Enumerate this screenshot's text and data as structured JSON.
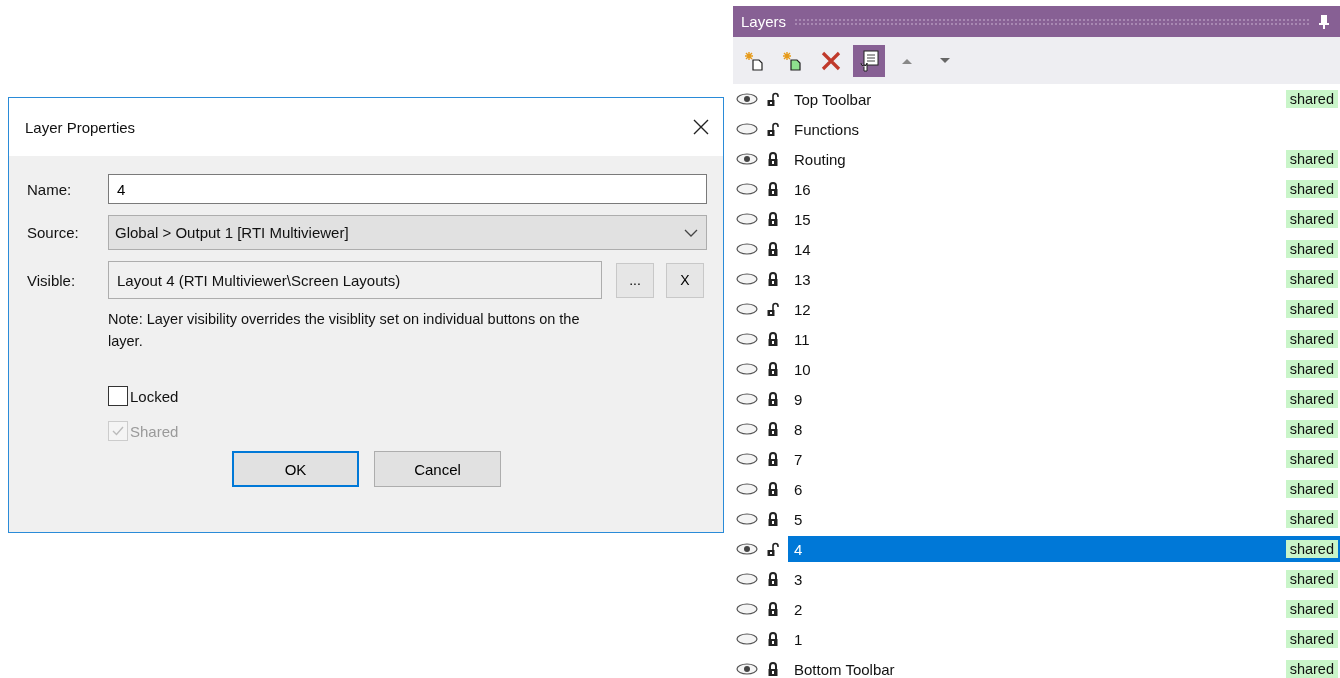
{
  "dialog": {
    "title": "Layer Properties",
    "name_label": "Name:",
    "name_value": "4",
    "source_label": "Source:",
    "source_value": "Global > Output 1 [RTI Multiviewer]",
    "visible_label": "Visible:",
    "visible_value": "Layout 4 (RTI Multiviewer\\Screen Layouts)",
    "browse_button": "...",
    "clear_button": "X",
    "note": "Note: Layer visibility overrides the visiblity set on individual buttons on the layer.",
    "checkboxes": [
      {
        "label": "Locked",
        "checked": false,
        "disabled": false
      },
      {
        "label": "Shared",
        "checked": true,
        "disabled": true
      }
    ],
    "buttons": [
      {
        "label": "OK",
        "default": true
      },
      {
        "label": "Cancel",
        "default": false
      }
    ]
  },
  "layers_panel": {
    "title": "Layers",
    "tools": [
      {
        "kind": "new",
        "pressed": false
      },
      {
        "kind": "new-filled",
        "pressed": false
      },
      {
        "kind": "delete",
        "pressed": false
      },
      {
        "kind": "properties",
        "pressed": true
      },
      {
        "kind": "up",
        "pressed": false
      },
      {
        "kind": "down",
        "pressed": false
      }
    ],
    "rows": [
      {
        "name": "Top Toolbar",
        "visible": true,
        "locked": false,
        "tag": "shared",
        "selected": false
      },
      {
        "name": "Functions",
        "visible": false,
        "locked": false,
        "selected": false
      },
      {
        "name": "Routing",
        "visible": true,
        "locked": true,
        "tag": "shared",
        "selected": false
      },
      {
        "name": "16",
        "visible": false,
        "locked": true,
        "tag": "shared",
        "selected": false
      },
      {
        "name": "15",
        "visible": false,
        "locked": true,
        "tag": "shared",
        "selected": false
      },
      {
        "name": "14",
        "visible": false,
        "locked": true,
        "tag": "shared",
        "selected": false
      },
      {
        "name": "13",
        "visible": false,
        "locked": true,
        "tag": "shared",
        "selected": false
      },
      {
        "name": "12",
        "visible": false,
        "locked": false,
        "tag": "shared",
        "selected": false
      },
      {
        "name": "11",
        "visible": false,
        "locked": true,
        "tag": "shared",
        "selected": false
      },
      {
        "name": "10",
        "visible": false,
        "locked": true,
        "tag": "shared",
        "selected": false
      },
      {
        "name": "9",
        "visible": false,
        "locked": true,
        "tag": "shared",
        "selected": false
      },
      {
        "name": "8",
        "visible": false,
        "locked": true,
        "tag": "shared",
        "selected": false
      },
      {
        "name": "7",
        "visible": false,
        "locked": true,
        "tag": "shared",
        "selected": false
      },
      {
        "name": "6",
        "visible": false,
        "locked": true,
        "tag": "shared",
        "selected": false
      },
      {
        "name": "5",
        "visible": false,
        "locked": true,
        "tag": "shared",
        "selected": false
      },
      {
        "name": "4",
        "visible": true,
        "locked": false,
        "tag": "shared",
        "selected": true
      },
      {
        "name": "3",
        "visible": false,
        "locked": true,
        "tag": "shared",
        "selected": false
      },
      {
        "name": "2",
        "visible": false,
        "locked": true,
        "tag": "shared",
        "selected": false
      },
      {
        "name": "1",
        "visible": false,
        "locked": true,
        "tag": "shared",
        "selected": false
      },
      {
        "name": "Bottom Toolbar",
        "visible": true,
        "locked": true,
        "tag": "shared",
        "selected": false
      }
    ]
  }
}
